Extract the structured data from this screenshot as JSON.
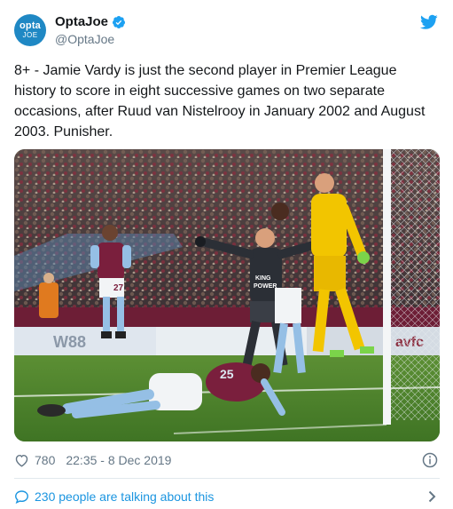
{
  "author": {
    "avatar_line1": "opta",
    "avatar_line2": "JOE",
    "name": "OptaJoe",
    "handle": "@OptaJoe"
  },
  "tweet": {
    "text": "8+ - Jamie Vardy is just the second player in Premier League history to score in eight successive games on two separate occasions, after Ruud van Nistelrooy in January 2002 and August 2003. Punisher."
  },
  "media": {
    "sponsor_shirt_line1": "KING",
    "sponsor_shirt_line2": "POWER",
    "board_text": "W88",
    "board_text_right": "avfc",
    "player_number": "25",
    "player_number_2": "27"
  },
  "meta": {
    "likes": "780",
    "timestamp": "22:35 - 8 Dec 2019"
  },
  "footer": {
    "talking_text": "230 people are talking about this"
  },
  "colors": {
    "accent_blue": "#1da1f2",
    "link_blue": "#1b95e0",
    "villa_claret": "#7a1f3d",
    "villa_blue": "#95bfe5",
    "keeper_yellow": "#f2c500",
    "pitch_green": "#4b7f2c"
  },
  "icons": {
    "verified": "verified-badge-icon",
    "bird": "twitter-bird-icon",
    "heart": "heart-icon",
    "info": "info-icon",
    "bubble": "speech-bubble-icon",
    "chevron": "chevron-right-icon"
  }
}
